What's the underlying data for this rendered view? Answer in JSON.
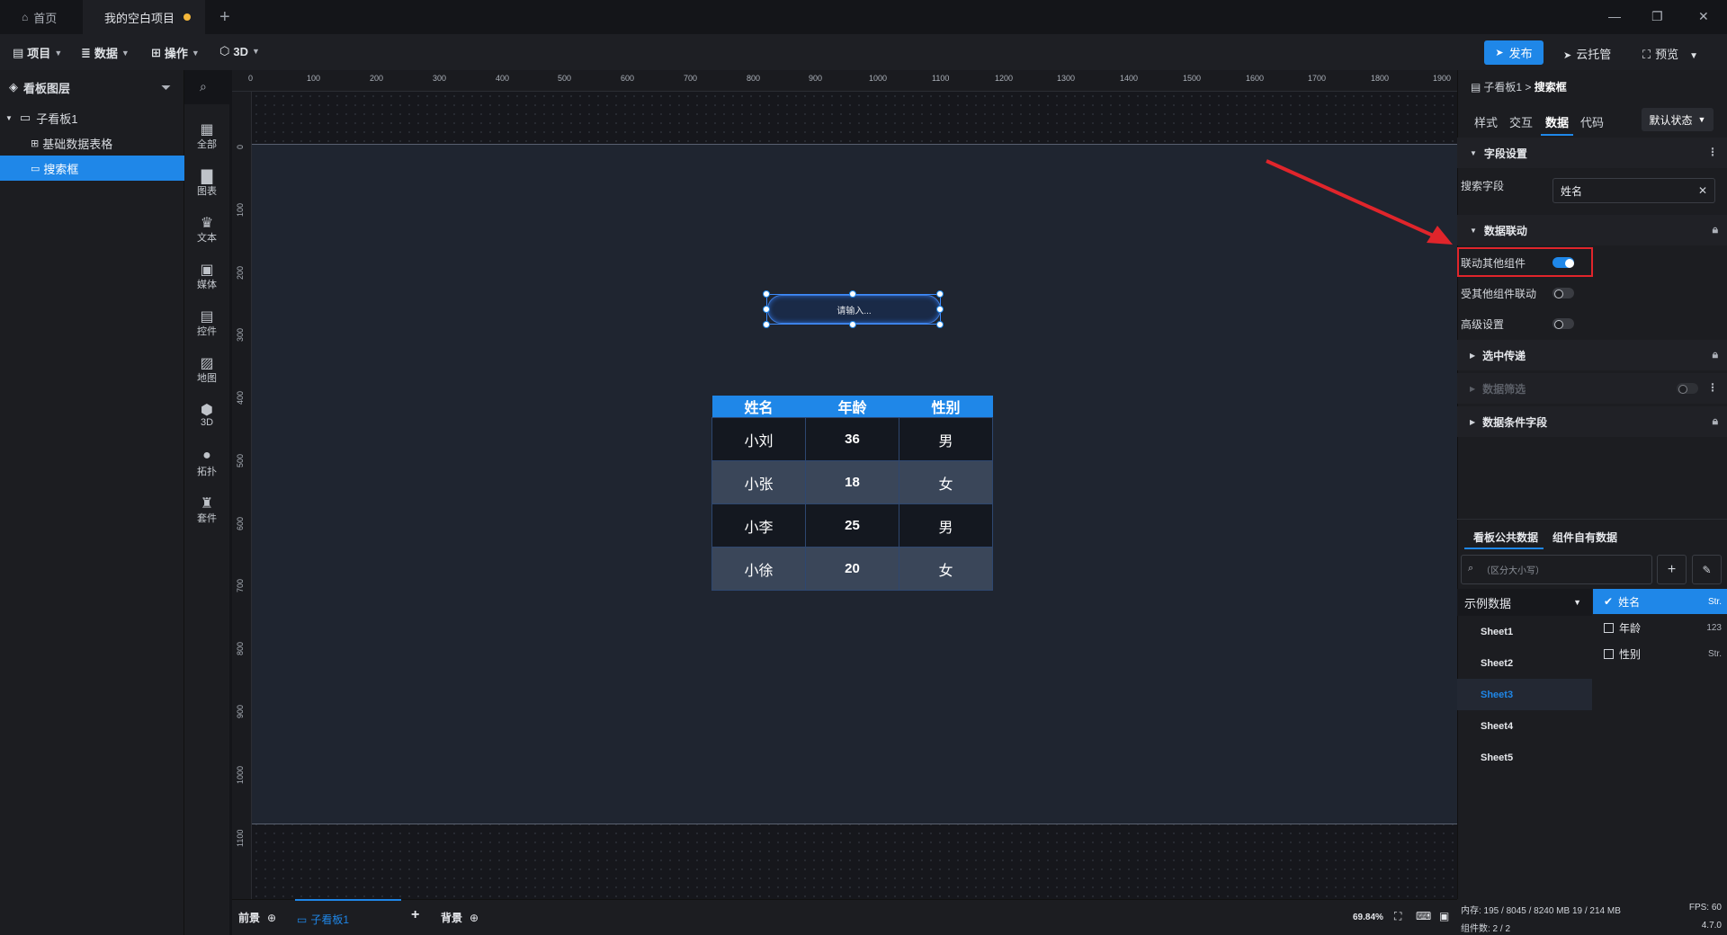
{
  "titlebar": {
    "home_tab": "首页",
    "project_tab": "我的空白项目",
    "new_tab": "+",
    "minimize": "—",
    "restore": "❐",
    "close": "✕"
  },
  "toolbar": {
    "menus": [
      "项目",
      "数据",
      "操作",
      "3D"
    ],
    "publish": "发布",
    "cloud_host": "云托管",
    "preview": "预览"
  },
  "layers": {
    "title": "看板图层",
    "board": "子看板1",
    "items": [
      "基础数据表格",
      "搜索框"
    ]
  },
  "component_bar": [
    "全部",
    "图表",
    "文本",
    "媒体",
    "控件",
    "地图",
    "3D",
    "拓扑",
    "套件"
  ],
  "ruler": {
    "top": [
      "0",
      "100",
      "200",
      "300",
      "400",
      "500",
      "600",
      "700",
      "800",
      "900",
      "1000",
      "1100",
      "1200",
      "1300",
      "1400",
      "1500",
      "1600",
      "1700",
      "1800",
      "1900"
    ],
    "left": [
      "0",
      "100",
      "200",
      "300",
      "400",
      "500",
      "600",
      "700",
      "800",
      "900",
      "1000",
      "1100"
    ]
  },
  "canvas": {
    "search_placeholder": "请输入...",
    "table": {
      "headers": [
        "姓名",
        "年龄",
        "性别"
      ],
      "rows": [
        [
          "小刘",
          "36",
          "男"
        ],
        [
          "小张",
          "18",
          "女"
        ],
        [
          "小李",
          "25",
          "男"
        ],
        [
          "小徐",
          "20",
          "女"
        ]
      ]
    }
  },
  "props": {
    "breadcrumb_parent": "子看板1",
    "breadcrumb_sep": ">",
    "breadcrumb_current": "搜索框",
    "tabs": [
      "样式",
      "交互",
      "数据",
      "代码"
    ],
    "active_tab": "数据",
    "state": "默认状态",
    "field_section": "字段设置",
    "search_field_label": "搜索字段",
    "search_field_value": "姓名",
    "linkage_section": "数据联动",
    "link_others": "联动其他组件",
    "link_others_on": true,
    "linked_by_others": "受其他组件联动",
    "linked_by_others_on": false,
    "advanced": "高级设置",
    "advanced_on": false,
    "selected_pass": "选中传递",
    "data_filter": "数据筛选",
    "condition_fields": "数据条件字段"
  },
  "data_panel": {
    "tabs": [
      "看板公共数据",
      "组件自有数据"
    ],
    "search_placeholder": "（区分大小写）",
    "dataset": "示例数据",
    "sheets": [
      "Sheet1",
      "Sheet2",
      "Sheet3",
      "Sheet4",
      "Sheet5"
    ],
    "active_sheet": "Sheet3",
    "columns": [
      {
        "name": "姓名",
        "type": "Str.",
        "checked": true
      },
      {
        "name": "年龄",
        "type": "123",
        "checked": false
      },
      {
        "name": "性别",
        "type": "Str.",
        "checked": false
      }
    ]
  },
  "bottom": {
    "foreground": "前景",
    "board": "子看板1",
    "background": "背景",
    "zoom": "69.84%"
  },
  "status": {
    "memory": "内存:  195 / 8045 / 8240 MB  19 / 214 MB",
    "fps": "FPS:  60",
    "components": "组件数: 2 / 2",
    "version": "4.7.0"
  },
  "colors": {
    "accent": "#1f87e8",
    "highlight": "#e0252b"
  }
}
